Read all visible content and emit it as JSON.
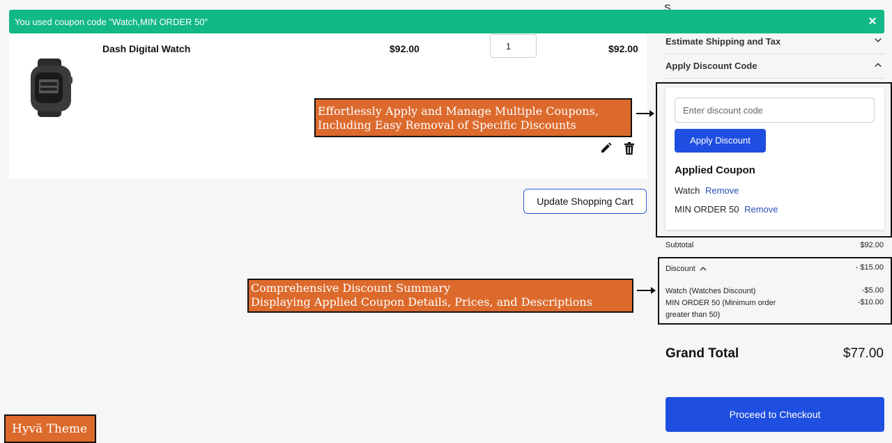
{
  "notice": {
    "message": "You used coupon code \"Watch,MIN ORDER 50\""
  },
  "cart": {
    "item": {
      "name": "Dash Digital Watch",
      "price": "$92.00",
      "quantity": "1",
      "row_total": "$92.00"
    },
    "update_label": "Update Shopping Cart"
  },
  "sidebar": {
    "top_fragment": "S",
    "estimate_label": "Estimate Shipping and Tax",
    "discount_label": "Apply Discount Code",
    "discount_form": {
      "placeholder": "Enter discount code",
      "apply_label": "Apply Discount",
      "applied_title": "Applied Coupon",
      "coupons": [
        {
          "code": "Watch",
          "remove": "Remove"
        },
        {
          "code": "MIN ORDER 50",
          "remove": "Remove"
        }
      ]
    },
    "totals": {
      "subtotal_label": "Subtotal",
      "subtotal_value": "$92.00",
      "discount_label": "Discount",
      "discount_value": "- $15.00",
      "details": [
        {
          "label": "Watch (Watches Discount)",
          "value": "-$5.00"
        },
        {
          "label": "MIN ORDER 50 (Minimum order greater than 50)",
          "value": "-$10.00"
        }
      ],
      "grand_total_label": "Grand Total",
      "grand_total_value": "$77.00"
    },
    "checkout_label": "Proceed to Checkout"
  },
  "annotations": {
    "coupons_line1": "Effortlessly Apply and Manage Multiple Coupons,",
    "coupons_line2": "Including Easy Removal of Specific Discounts",
    "summary_line1": "Comprehensive Discount Summary",
    "summary_line2": "Displaying Applied Coupon Details, Prices, and Descriptions",
    "theme": "Hyvä Theme"
  },
  "colors": {
    "notice": "#12b886",
    "primary": "#1f4fe0",
    "callout": "#dc6a2c",
    "link": "#2b4fb5"
  }
}
